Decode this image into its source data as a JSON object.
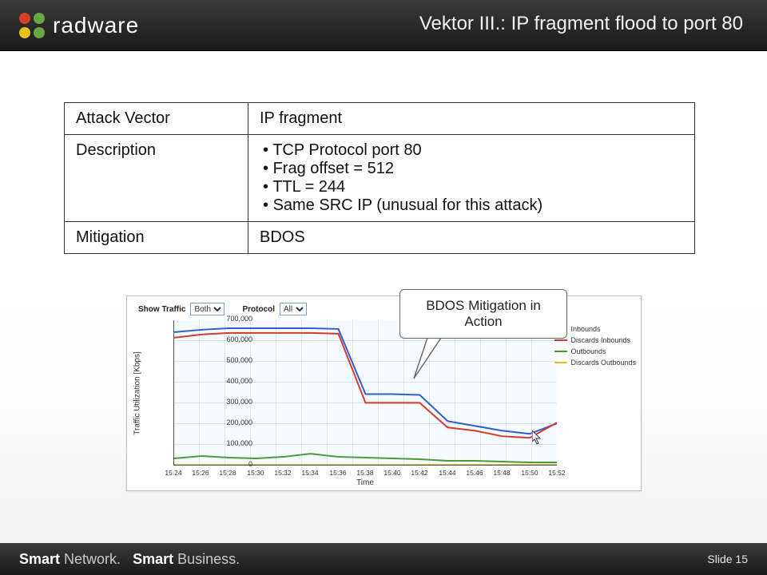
{
  "brand": "radware",
  "page_title": "Vektor III.: IP fragment flood to port 80",
  "table": {
    "rows": [
      {
        "label": "Attack Vector",
        "value": "IP fragment"
      },
      {
        "label": "Description",
        "bullets": [
          "TCP Protocol port 80",
          "Frag offset = 512",
          "TTL = 244",
          "Same SRC IP (unusual for this attack)"
        ]
      },
      {
        "label": "Mitigation",
        "value": "BDOS"
      }
    ]
  },
  "callout": "BDOS Mitigation in Action",
  "chart_toolbar": {
    "show_traffic_label": "Show Traffic",
    "show_traffic_value": "Both",
    "protocol_label": "Protocol",
    "protocol_value": "All"
  },
  "chart_data": {
    "type": "line",
    "title": "",
    "xlabel": "Time",
    "ylabel": "Traffic Utilization [Kbps]",
    "ylim": [
      0,
      700000
    ],
    "x": [
      "15:24",
      "15:26",
      "15:28",
      "15:30",
      "15:32",
      "15:34",
      "15:36",
      "15:38",
      "15:40",
      "15:42",
      "15:44",
      "15:46",
      "15:48",
      "15:50",
      "15:52"
    ],
    "yticks": [
      0,
      100000,
      200000,
      300000,
      400000,
      500000,
      600000,
      700000
    ],
    "series": [
      {
        "name": "Inbounds",
        "color": "blue",
        "values": [
          640000,
          655000,
          660000,
          660000,
          660000,
          660000,
          655000,
          340000,
          340000,
          335000,
          210000,
          190000,
          165000,
          150000,
          200000
        ]
      },
      {
        "name": "Discards Inbounds",
        "color": "red",
        "values": [
          615000,
          630000,
          640000,
          640000,
          640000,
          640000,
          635000,
          300000,
          300000,
          300000,
          180000,
          165000,
          140000,
          130000,
          205000
        ]
      },
      {
        "name": "Outbounds",
        "color": "green",
        "values": [
          28000,
          42000,
          35000,
          30000,
          40000,
          55000,
          40000,
          35000,
          30000,
          25000,
          20000,
          18000,
          15000,
          12000,
          10000
        ]
      },
      {
        "name": "Discards Outbounds",
        "color": "yellow",
        "values": [
          0,
          0,
          0,
          0,
          0,
          0,
          0,
          0,
          0,
          0,
          0,
          0,
          0,
          0,
          0
        ]
      }
    ]
  },
  "footer": {
    "line1_bold": "Smart",
    "line1_rest": " Network.",
    "line2_bold": "Smart",
    "line2_rest": " Business.",
    "slide_label": "Slide 15"
  }
}
